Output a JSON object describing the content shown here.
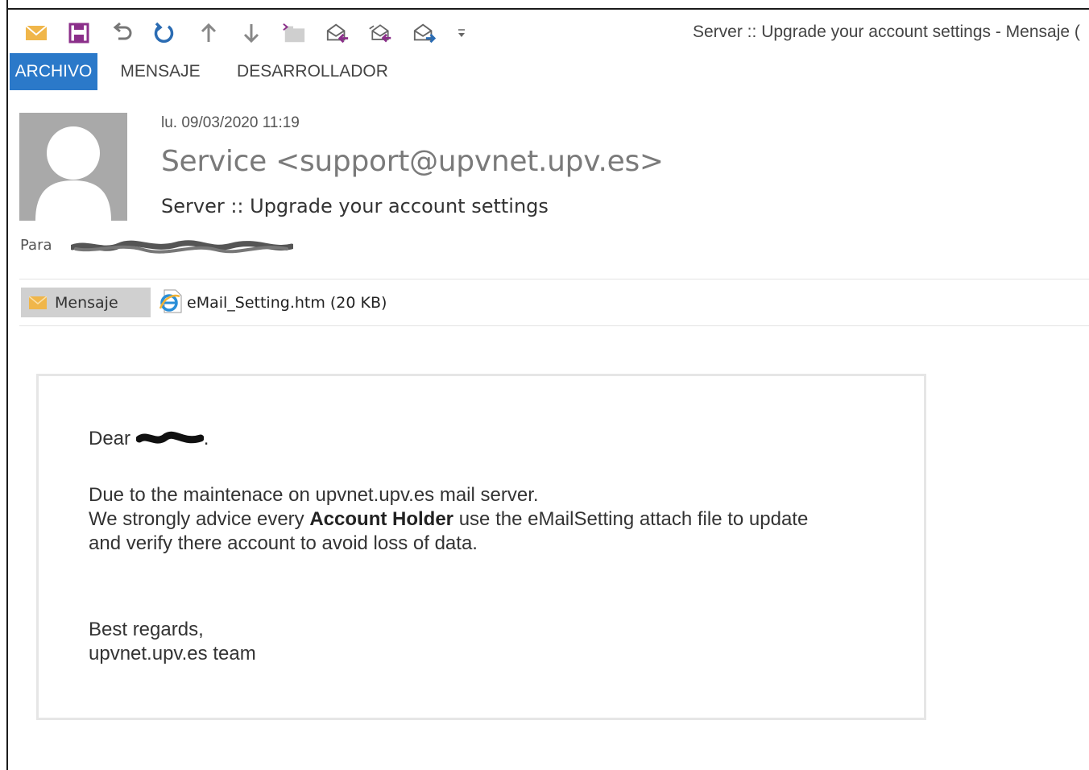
{
  "window": {
    "title": "Server :: Upgrade your account settings - Mensaje ("
  },
  "qat": {
    "icons": [
      "mail-icon",
      "save-icon",
      "undo-icon",
      "redo-icon",
      "up-arrow-icon",
      "down-arrow-icon",
      "move-folder-icon",
      "reply-icon",
      "reply-all-icon",
      "forward-icon",
      "customize-dropdown-icon"
    ]
  },
  "ribbon": {
    "tabs": [
      {
        "label": "ARCHIVO",
        "active": true
      },
      {
        "label": "MENSAJE",
        "active": false
      },
      {
        "label": "DESARROLLADOR",
        "active": false
      }
    ]
  },
  "message": {
    "date": "lu. 09/03/2020 11:19",
    "sender": "Service <support@upvnet.upv.es>",
    "subject": "Server :: Upgrade your account settings",
    "to_label": "Para"
  },
  "attachments": {
    "message_tab_label": "Mensaje",
    "file_label": "eMail_Setting.htm (20 KB)"
  },
  "body": {
    "greeting_prefix": "Dear",
    "greeting_suffix": ".",
    "line1": "Due to the maintenace on upvnet.upv.es mail server.",
    "line2_prefix": "We strongly advice every",
    "line2_bold": "Account Holder",
    "line2_suffix": "use the eMailSetting attach file to update",
    "line3": "and verify there account to avoid loss of data.",
    "signoff": "Best regards,",
    "signature": "upvnet.upv.es team"
  },
  "colors": {
    "ribbon_active": "#2b79c9",
    "icon_blue": "#2b6cb3",
    "icon_purple": "#8b2f8a",
    "envelope": "#f0b64a"
  }
}
